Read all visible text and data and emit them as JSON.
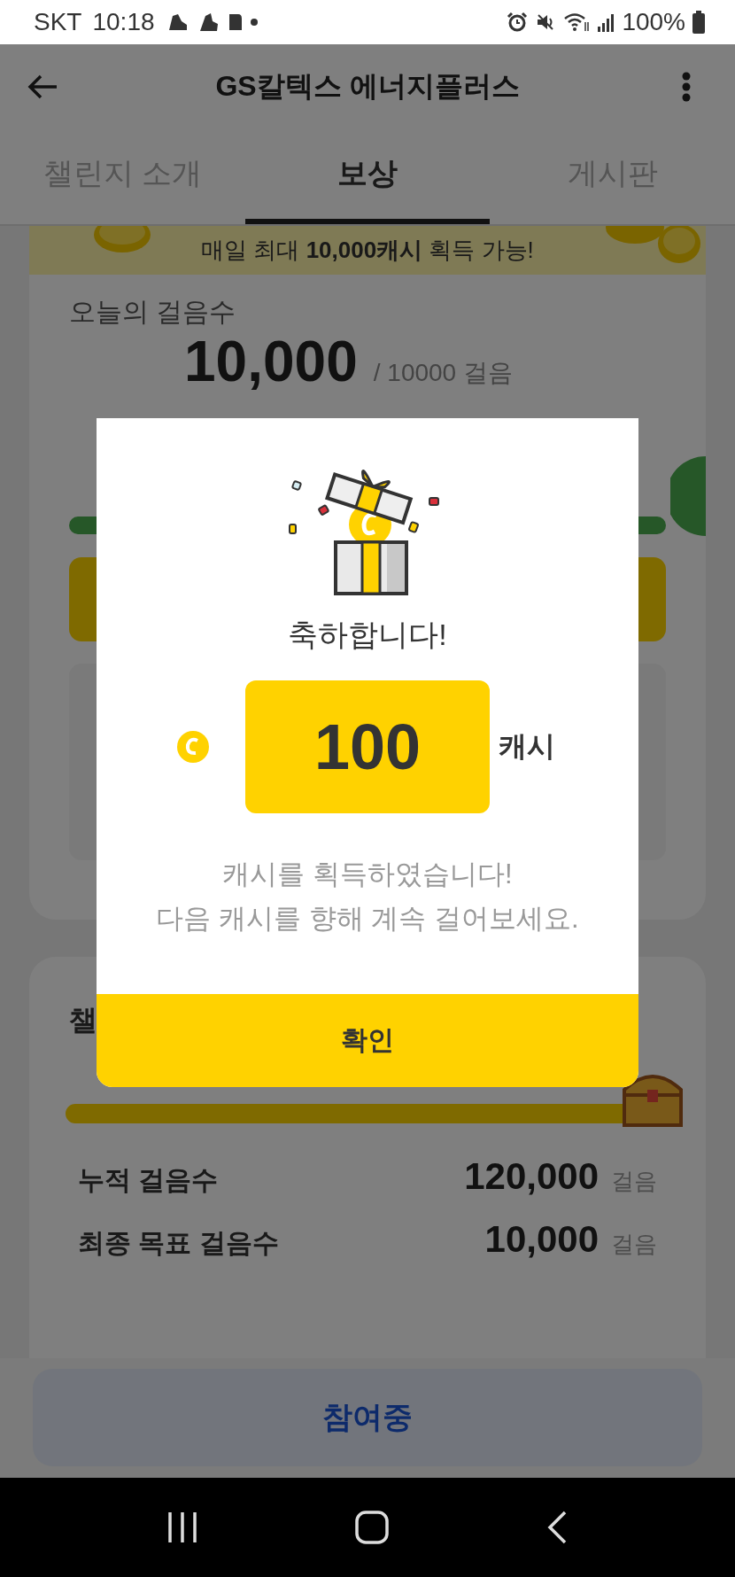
{
  "status_bar": {
    "carrier": "SKT",
    "time": "10:18",
    "battery": "100%"
  },
  "app_bar": {
    "title": "GS칼텍스 에너지플러스"
  },
  "tabs": [
    {
      "label": "챌린지 소개",
      "selected": false
    },
    {
      "label": "보상",
      "selected": true
    },
    {
      "label": "게시판",
      "selected": false
    }
  ],
  "banner": {
    "text": "매일 최대 **10,000캐시** 획득 가능!"
  },
  "today_card": {
    "title": "오늘의 걸음수",
    "steps": "10,000",
    "goal": "/ 10000 걸음",
    "level": 1
  },
  "challenge_card": {
    "title": "챌",
    "level": 1,
    "rows": [
      {
        "label": "누적 걸음수",
        "value": "120,000",
        "unit": "걸음"
      },
      {
        "label": "최종 목표 걸음수",
        "value": "10,000",
        "unit": "걸음"
      }
    ]
  },
  "bottom_button": {
    "label": "참여중"
  },
  "dialog": {
    "title": "축하합니다!",
    "amount": "100",
    "unit": "캐시",
    "message_lines": [
      "캐시를 획득하였습니다!",
      "다음 캐시를 향해 계속 걸어보세요."
    ],
    "confirm": "확인"
  }
}
